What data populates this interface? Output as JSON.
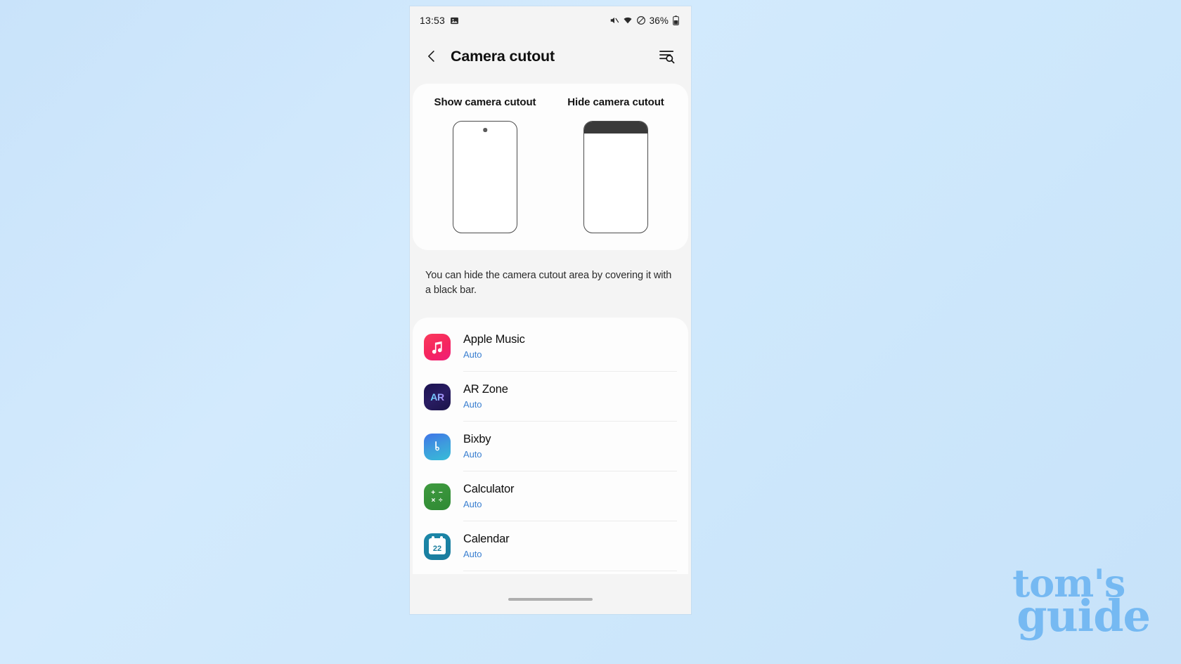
{
  "statusbar": {
    "time": "13:53",
    "image_icon": "image-icon",
    "mute_icon": "speaker-mute-icon",
    "wifi_icon": "wifi-icon",
    "dnd_icon": "do-not-disturb-icon",
    "battery_percent": "36%",
    "battery_icon": "battery-icon"
  },
  "appbar": {
    "back_icon": "back-chevron-icon",
    "title": "Camera cutout",
    "search_icon": "search-list-icon"
  },
  "preview": {
    "options": [
      {
        "label": "Show camera cutout",
        "mode": "show"
      },
      {
        "label": "Hide camera cutout",
        "mode": "hide"
      }
    ]
  },
  "description": "You can hide the camera cutout area by covering it with a black bar.",
  "apps": [
    {
      "name": "Apple Music",
      "state": "Auto",
      "icon": "apple-music-icon"
    },
    {
      "name": "AR Zone",
      "state": "Auto",
      "icon": "ar-zone-icon",
      "badge": "AR"
    },
    {
      "name": "Bixby",
      "state": "Auto",
      "icon": "bixby-icon"
    },
    {
      "name": "Calculator",
      "state": "Auto",
      "icon": "calculator-icon",
      "symbols_top": "+ −",
      "symbols_bottom": "× ÷"
    },
    {
      "name": "Calendar",
      "state": "Auto",
      "icon": "calendar-icon",
      "day": "22"
    }
  ],
  "navbar": {
    "gesture_pill": "gesture-pill"
  },
  "watermark": {
    "line1": "tom's",
    "line2": "guide"
  },
  "colors": {
    "background_top": "#c9e3fa",
    "background_bottom": "#c7e2f9",
    "card": "#fdfdfd",
    "surface": "#f4f4f4",
    "state_text": "#3a7fd0",
    "watermark": "#6fb6f2"
  }
}
